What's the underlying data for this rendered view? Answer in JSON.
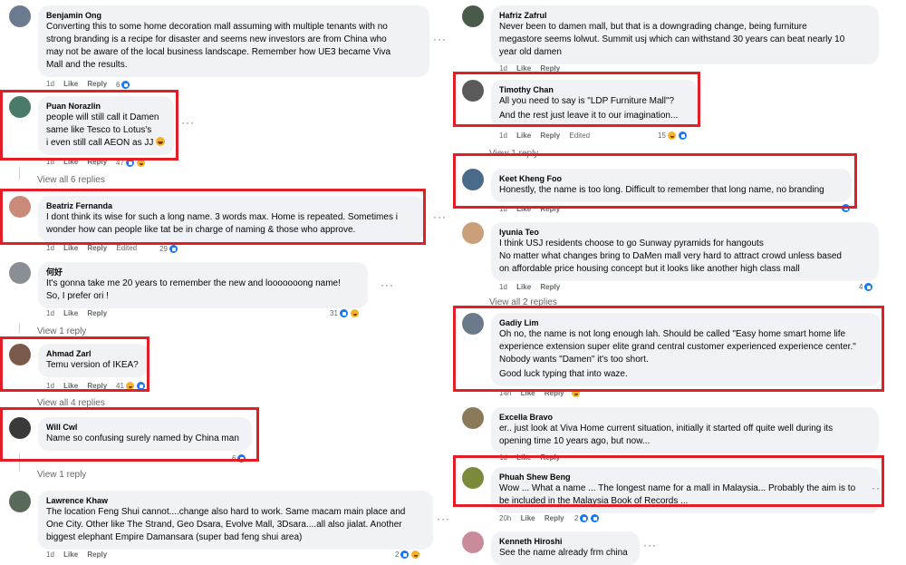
{
  "actions": {
    "like": "Like",
    "reply": "Reply",
    "edited": "Edited"
  },
  "left": [
    {
      "id": "benjamin",
      "name": "Benjamin Ong",
      "avatar_color": "#6b7a8f",
      "text": "Converting this to some home decoration mall assuming with multiple tenants with no\nstrong branding is a recipe for disaster and seems new investors are from China who\nmay not be aware of the local business landscape. Remember how UE3 became Viva\nMall and the results.",
      "time": "1d",
      "reactions": "6"
    },
    {
      "id": "puan",
      "name": "Puan Norazlin",
      "avatar_color": "#4a7a6a",
      "text": "people will still call it Damen\nsame like Tesco to Lotus's\ni even still call AEON as JJ",
      "time": "1d",
      "reactions": "47",
      "view_replies": "View all 6 replies"
    },
    {
      "id": "beatriz",
      "name": "Beatriz Fernanda",
      "avatar_color": "#c98a7a",
      "text": "I dont think its wise for such a long name. 3 words max. Home is repeated. Sometimes i\nwonder how can people like tat be in charge of naming & those who approve.",
      "time": "1d",
      "reactions": "29"
    },
    {
      "id": "hehao",
      "name": "何好",
      "avatar_color": "#8a8f96",
      "text": "It's gonna take me 20 years to remember the new and looooooong name!\nSo, I prefer ori !",
      "time": "1d",
      "reactions": "31",
      "view_replies": "View 1 reply"
    },
    {
      "id": "ahmad",
      "name": "Ahmad Zarl",
      "avatar_color": "#7a5a4a",
      "text": "Temu version of IKEA?",
      "time": "1d",
      "reactions": "41",
      "view_replies": "View all 4 replies"
    },
    {
      "id": "will",
      "name": "Will Cwl",
      "avatar_color": "#3a3a3a",
      "text": "Name so confusing surely named by China man",
      "time": "1d",
      "reactions": "6",
      "view_replies": "View 1 reply"
    },
    {
      "id": "lawrence",
      "name": "Lawrence Khaw",
      "avatar_color": "#5a6a5a",
      "text": "The location Feng Shui cannot....change also hard to work. Same macam main place and\nOne City. Other like The Strand, Geo Dsara, Evolve Mall, 3Dsara....all also jialat. Another\nbiggest elephant Empire Damansara (super bad feng shui area)",
      "time": "1d",
      "reactions": "2"
    }
  ],
  "right": [
    {
      "id": "hafriz",
      "name": "Hafriz Zafrul",
      "avatar_color": "#4a5a4a",
      "text": "Never been to damen mall, but that is a downgrading change, being furniture\nmegastore seems lolwut. Summit usj which can withstand 30 years can beat nearly 10\nyear old damen",
      "time": "1d"
    },
    {
      "id": "timothy",
      "name": "Timothy Chan",
      "avatar_color": "#5a5a5a",
      "text": "All you need to say is \"LDP Furniture Mall\"?",
      "text2": "And the rest just leave it to our imagination...",
      "time": "1d",
      "reactions": "15",
      "view_replies": "View 1 reply"
    },
    {
      "id": "keet",
      "name": "Keet Kheng Foo",
      "avatar_color": "#4a6a8a",
      "text": "Honestly, the name is too long. Difficult to remember that long name, no branding",
      "time": "1d"
    },
    {
      "id": "iyunia",
      "name": "Iyunia Teo",
      "avatar_color": "#c9a07a",
      "text": "I think USJ residents choose to go Sunway pyramids for hangouts\nNo matter what changes bring to DaMen mall very hard to attract crowd unless based\non affordable price housing concept but it looks like another high class mall",
      "time": "1d",
      "reactions": "4",
      "view_replies": "View all 2 replies"
    },
    {
      "id": "gadiy",
      "name": "Gadiy Lim",
      "avatar_color": "#6a7a8a",
      "text": "Oh no, the name is not long enough lah. Should be called \"Easy home smart home life\nexperience extension super elite grand central customer experienced experience center.\"\nNobody wants \"Damen\" it's too short.",
      "text2": "Good luck typing that into waze.",
      "time": "14h"
    },
    {
      "id": "excella",
      "name": "Excella Bravo",
      "avatar_color": "#8a7a5a",
      "text": "er.. just look at Viva Home current situation, initially it started off quite well during its\nopening time 10 years ago, but now...",
      "time": "1d"
    },
    {
      "id": "phuah",
      "name": "Phuah Shew Beng",
      "avatar_color": "#7a8a3a",
      "text": "Wow ... What a name ... The longest name for a mall in Malaysia... Probably the aim is to\nbe included in the Malaysia Book of Records ...",
      "time": "20h",
      "reactions": "2"
    },
    {
      "id": "kenneth",
      "name": "Kenneth Hiroshi",
      "avatar_color": "#c98a9a",
      "text": "See the name already frm china"
    }
  ]
}
